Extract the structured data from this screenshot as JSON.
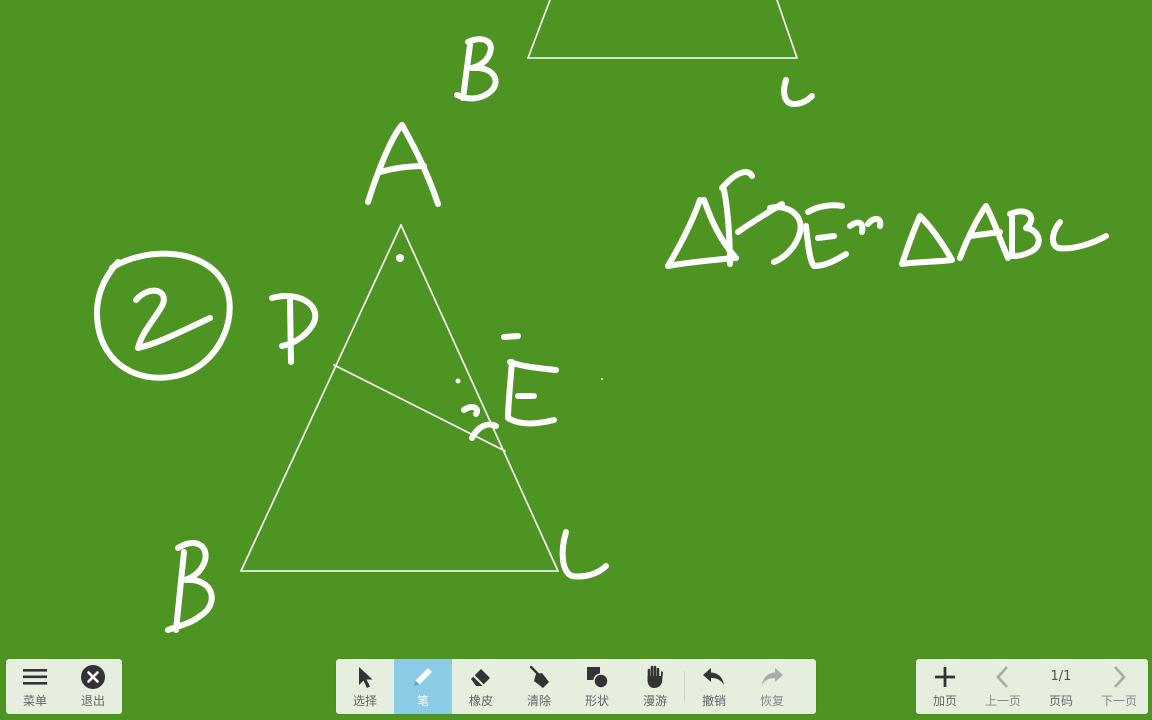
{
  "board": {
    "background_color": "#4d9423",
    "ink_color": "#ffffff",
    "handwriting": {
      "top_label_b": "B",
      "top_label_c": "C",
      "label_a": "A",
      "label_d": "D",
      "label_e": "E",
      "label_b": "B",
      "label_c": "C",
      "problem_number": "2",
      "similarity_statement": "△ADE∽△ABC"
    }
  },
  "left_toolbar": {
    "menu_label": "菜单",
    "exit_label": "退出"
  },
  "center_toolbar": {
    "select_label": "选择",
    "pen_label": "笔",
    "eraser_label": "橡皮",
    "clear_label": "清除",
    "shape_label": "形状",
    "roam_label": "漫游",
    "undo_label": "撤销",
    "redo_label": "恢复",
    "active_tool": "笔",
    "active_color": "#8ccbe6"
  },
  "right_toolbar": {
    "add_page_label": "加页",
    "prev_page_label": "上一页",
    "page_indicator": "1/1",
    "page_number_label": "页码",
    "next_page_label": "下一页"
  }
}
